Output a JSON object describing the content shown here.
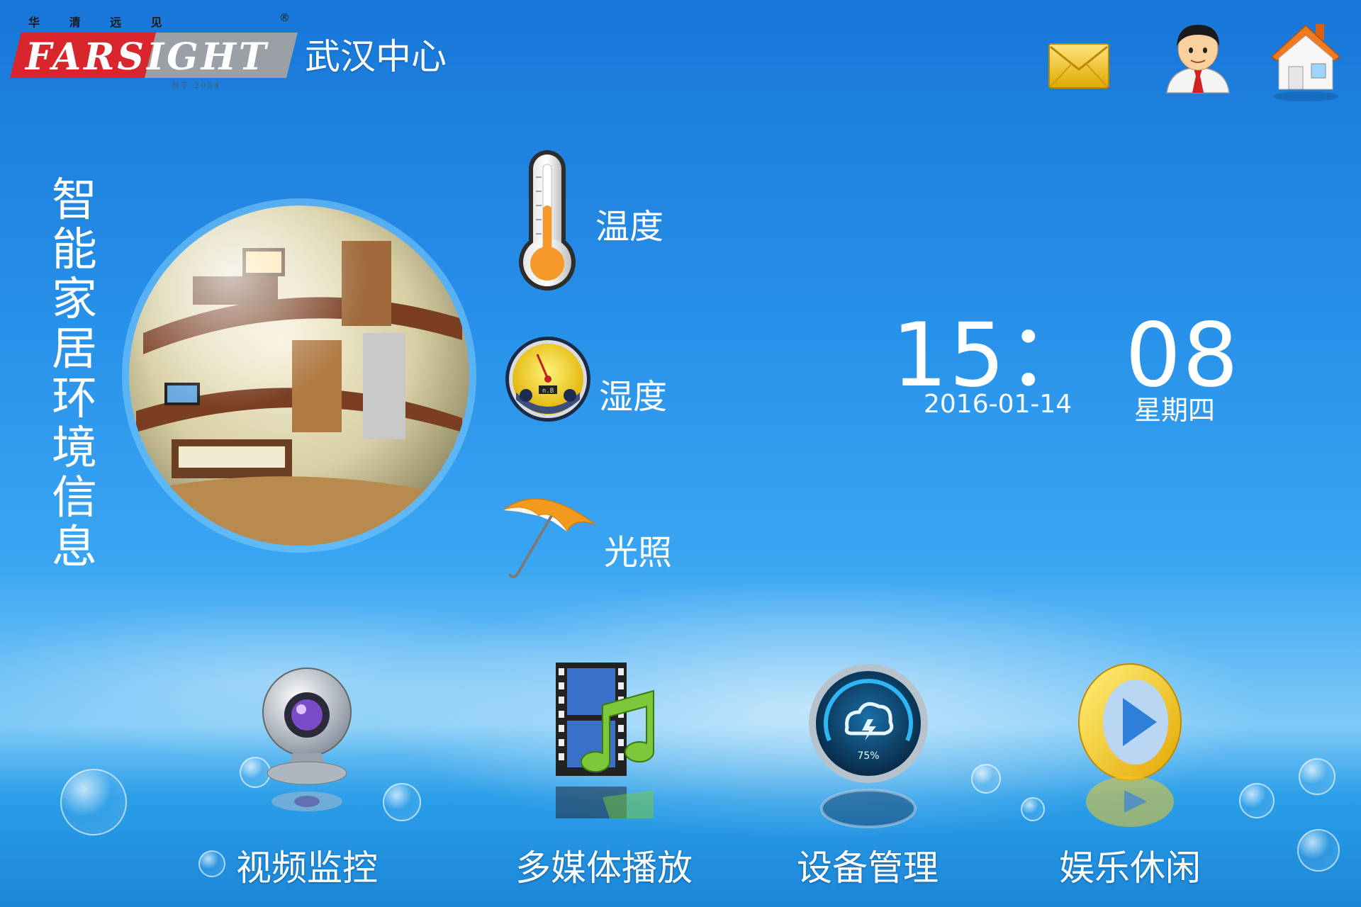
{
  "header": {
    "logo": {
      "top_text": "华 清 远 见",
      "brand": "FARSIGHT",
      "sub_text": "创于 2004",
      "registered_mark": "®"
    },
    "center_name": "武汉中心",
    "icons": [
      "mail-icon",
      "user-icon",
      "home-icon"
    ]
  },
  "side_title": "智能家居环境信息",
  "environment": {
    "temperature_label": "温度",
    "humidity_label": "湿度",
    "light_label": "光照",
    "humidity_gauge_text": "n.B"
  },
  "clock": {
    "time": "15： 08",
    "date": "2016-01-14",
    "weekday": "星期四"
  },
  "menu": [
    {
      "label": "视频监控",
      "icon": "webcam-icon"
    },
    {
      "label": "多媒体播放",
      "icon": "film-music-icon"
    },
    {
      "label": "设备管理",
      "icon": "cloud-gauge-icon",
      "gauge_text": "75%"
    },
    {
      "label": "娱乐休闲",
      "icon": "play-ring-icon"
    }
  ],
  "colors": {
    "sky_top": "#1876d8",
    "sky_mid": "#3aa6f2",
    "logo_red": "#d9252c",
    "logo_grey": "#9aa0a6"
  }
}
